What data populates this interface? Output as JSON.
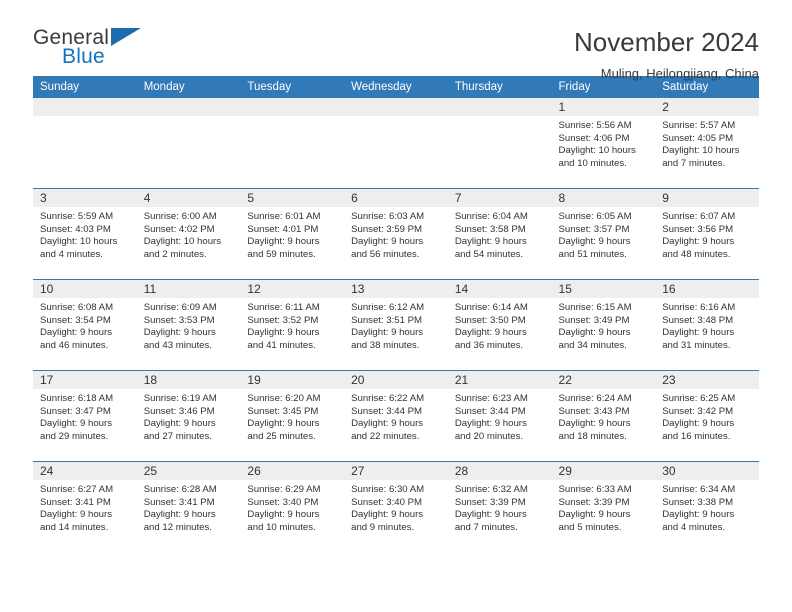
{
  "logo": {
    "word_top": "General",
    "word_bottom": "Blue",
    "triangle_icon": "triangle-icon",
    "brand_color": "#1175bb",
    "triangle_color": "#1b6cb0"
  },
  "header": {
    "title": "November 2024",
    "subtitle": "Muling, Heilongjiang, China"
  },
  "theme": {
    "header_row_bg": "#3179b7",
    "daynum_band_bg": "#eeeeee",
    "text_color": "#333333"
  },
  "calendar": {
    "weekday_headers": [
      "Sunday",
      "Monday",
      "Tuesday",
      "Wednesday",
      "Thursday",
      "Friday",
      "Saturday"
    ],
    "weeks": [
      [
        {
          "day": "",
          "lines": []
        },
        {
          "day": "",
          "lines": []
        },
        {
          "day": "",
          "lines": []
        },
        {
          "day": "",
          "lines": []
        },
        {
          "day": "",
          "lines": []
        },
        {
          "day": "1",
          "lines": [
            "Sunrise: 5:56 AM",
            "Sunset: 4:06 PM",
            "Daylight: 10 hours",
            "and 10 minutes."
          ]
        },
        {
          "day": "2",
          "lines": [
            "Sunrise: 5:57 AM",
            "Sunset: 4:05 PM",
            "Daylight: 10 hours",
            "and 7 minutes."
          ]
        }
      ],
      [
        {
          "day": "3",
          "lines": [
            "Sunrise: 5:59 AM",
            "Sunset: 4:03 PM",
            "Daylight: 10 hours",
            "and 4 minutes."
          ]
        },
        {
          "day": "4",
          "lines": [
            "Sunrise: 6:00 AM",
            "Sunset: 4:02 PM",
            "Daylight: 10 hours",
            "and 2 minutes."
          ]
        },
        {
          "day": "5",
          "lines": [
            "Sunrise: 6:01 AM",
            "Sunset: 4:01 PM",
            "Daylight: 9 hours",
            "and 59 minutes."
          ]
        },
        {
          "day": "6",
          "lines": [
            "Sunrise: 6:03 AM",
            "Sunset: 3:59 PM",
            "Daylight: 9 hours",
            "and 56 minutes."
          ]
        },
        {
          "day": "7",
          "lines": [
            "Sunrise: 6:04 AM",
            "Sunset: 3:58 PM",
            "Daylight: 9 hours",
            "and 54 minutes."
          ]
        },
        {
          "day": "8",
          "lines": [
            "Sunrise: 6:05 AM",
            "Sunset: 3:57 PM",
            "Daylight: 9 hours",
            "and 51 minutes."
          ]
        },
        {
          "day": "9",
          "lines": [
            "Sunrise: 6:07 AM",
            "Sunset: 3:56 PM",
            "Daylight: 9 hours",
            "and 48 minutes."
          ]
        }
      ],
      [
        {
          "day": "10",
          "lines": [
            "Sunrise: 6:08 AM",
            "Sunset: 3:54 PM",
            "Daylight: 9 hours",
            "and 46 minutes."
          ]
        },
        {
          "day": "11",
          "lines": [
            "Sunrise: 6:09 AM",
            "Sunset: 3:53 PM",
            "Daylight: 9 hours",
            "and 43 minutes."
          ]
        },
        {
          "day": "12",
          "lines": [
            "Sunrise: 6:11 AM",
            "Sunset: 3:52 PM",
            "Daylight: 9 hours",
            "and 41 minutes."
          ]
        },
        {
          "day": "13",
          "lines": [
            "Sunrise: 6:12 AM",
            "Sunset: 3:51 PM",
            "Daylight: 9 hours",
            "and 38 minutes."
          ]
        },
        {
          "day": "14",
          "lines": [
            "Sunrise: 6:14 AM",
            "Sunset: 3:50 PM",
            "Daylight: 9 hours",
            "and 36 minutes."
          ]
        },
        {
          "day": "15",
          "lines": [
            "Sunrise: 6:15 AM",
            "Sunset: 3:49 PM",
            "Daylight: 9 hours",
            "and 34 minutes."
          ]
        },
        {
          "day": "16",
          "lines": [
            "Sunrise: 6:16 AM",
            "Sunset: 3:48 PM",
            "Daylight: 9 hours",
            "and 31 minutes."
          ]
        }
      ],
      [
        {
          "day": "17",
          "lines": [
            "Sunrise: 6:18 AM",
            "Sunset: 3:47 PM",
            "Daylight: 9 hours",
            "and 29 minutes."
          ]
        },
        {
          "day": "18",
          "lines": [
            "Sunrise: 6:19 AM",
            "Sunset: 3:46 PM",
            "Daylight: 9 hours",
            "and 27 minutes."
          ]
        },
        {
          "day": "19",
          "lines": [
            "Sunrise: 6:20 AM",
            "Sunset: 3:45 PM",
            "Daylight: 9 hours",
            "and 25 minutes."
          ]
        },
        {
          "day": "20",
          "lines": [
            "Sunrise: 6:22 AM",
            "Sunset: 3:44 PM",
            "Daylight: 9 hours",
            "and 22 minutes."
          ]
        },
        {
          "day": "21",
          "lines": [
            "Sunrise: 6:23 AM",
            "Sunset: 3:44 PM",
            "Daylight: 9 hours",
            "and 20 minutes."
          ]
        },
        {
          "day": "22",
          "lines": [
            "Sunrise: 6:24 AM",
            "Sunset: 3:43 PM",
            "Daylight: 9 hours",
            "and 18 minutes."
          ]
        },
        {
          "day": "23",
          "lines": [
            "Sunrise: 6:25 AM",
            "Sunset: 3:42 PM",
            "Daylight: 9 hours",
            "and 16 minutes."
          ]
        }
      ],
      [
        {
          "day": "24",
          "lines": [
            "Sunrise: 6:27 AM",
            "Sunset: 3:41 PM",
            "Daylight: 9 hours",
            "and 14 minutes."
          ]
        },
        {
          "day": "25",
          "lines": [
            "Sunrise: 6:28 AM",
            "Sunset: 3:41 PM",
            "Daylight: 9 hours",
            "and 12 minutes."
          ]
        },
        {
          "day": "26",
          "lines": [
            "Sunrise: 6:29 AM",
            "Sunset: 3:40 PM",
            "Daylight: 9 hours",
            "and 10 minutes."
          ]
        },
        {
          "day": "27",
          "lines": [
            "Sunrise: 6:30 AM",
            "Sunset: 3:40 PM",
            "Daylight: 9 hours",
            "and 9 minutes."
          ]
        },
        {
          "day": "28",
          "lines": [
            "Sunrise: 6:32 AM",
            "Sunset: 3:39 PM",
            "Daylight: 9 hours",
            "and 7 minutes."
          ]
        },
        {
          "day": "29",
          "lines": [
            "Sunrise: 6:33 AM",
            "Sunset: 3:39 PM",
            "Daylight: 9 hours",
            "and 5 minutes."
          ]
        },
        {
          "day": "30",
          "lines": [
            "Sunrise: 6:34 AM",
            "Sunset: 3:38 PM",
            "Daylight: 9 hours",
            "and 4 minutes."
          ]
        }
      ]
    ]
  }
}
